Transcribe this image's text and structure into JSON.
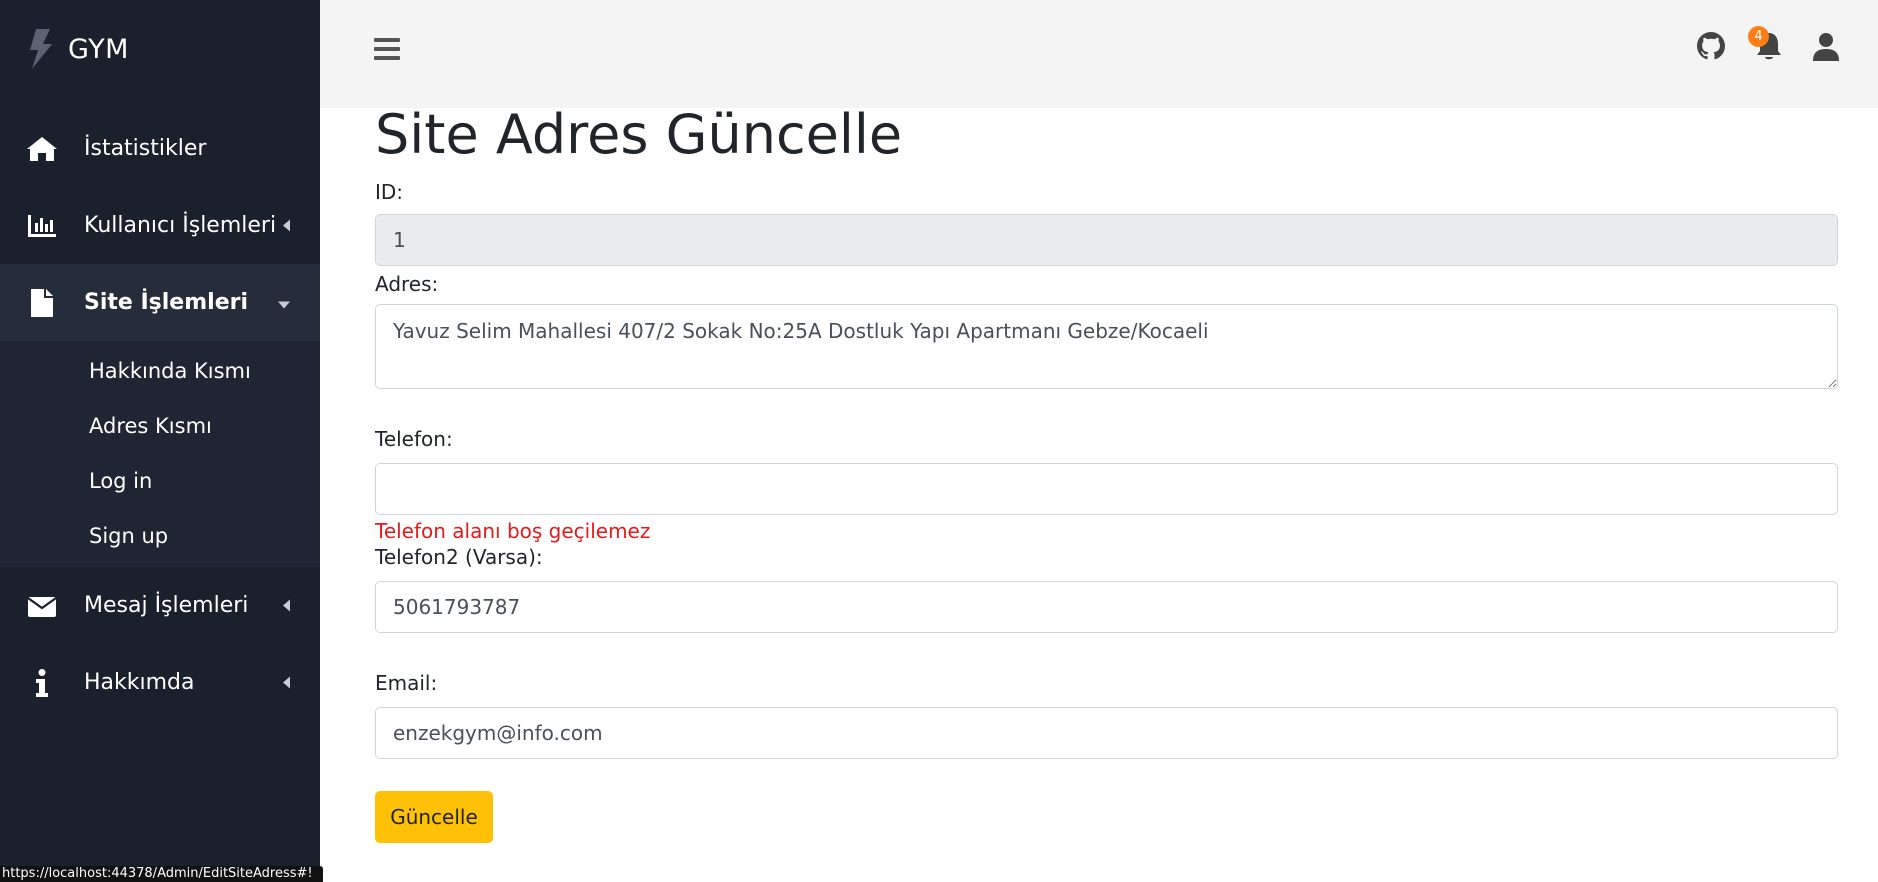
{
  "brand": {
    "name": "GYM"
  },
  "sidebar": {
    "items": [
      {
        "label": "İstatistikler",
        "icon": "home-icon"
      },
      {
        "label": "Kullanıcı İşlemleri",
        "icon": "chart-bar-icon"
      },
      {
        "label": "Site İşlemleri",
        "icon": "file-icon",
        "expanded": true,
        "children": [
          {
            "label": "Hakkında Kısmı"
          },
          {
            "label": "Adres Kısmı"
          },
          {
            "label": "Log in"
          },
          {
            "label": "Sign up"
          }
        ]
      },
      {
        "label": "Mesaj İşlemleri",
        "icon": "envelope-icon"
      },
      {
        "label": "Hakkımda",
        "icon": "info-icon"
      }
    ]
  },
  "topbar": {
    "notification_count": "4"
  },
  "form": {
    "title": "Site Adres Güncelle",
    "id_label": "ID:",
    "id_value": "1",
    "address_label": "Adres:",
    "address_value": "Yavuz Selim Mahallesi 407/2 Sokak No:25A Dostluk Yapı Apartmanı Gebze/Kocaeli",
    "phone_label": "Telefon:",
    "phone_value": "",
    "phone_error": "Telefon alanı boş geçilemez",
    "phone2_label": "Telefon2 (Varsa):",
    "phone2_value": "5061793787",
    "email_label": "Email:",
    "email_value": "enzekgym@info.com",
    "submit_label": "Güncelle"
  },
  "status_bar": {
    "url": "https://localhost:44378/Admin/EditSiteAdress#!"
  },
  "colors": {
    "sidebar_bg": "#1a202c",
    "topbar_bg": "#f4f4f4",
    "button_bg": "#ffc107",
    "error_text": "#e31b1b",
    "badge_bg": "#fd7e14"
  }
}
